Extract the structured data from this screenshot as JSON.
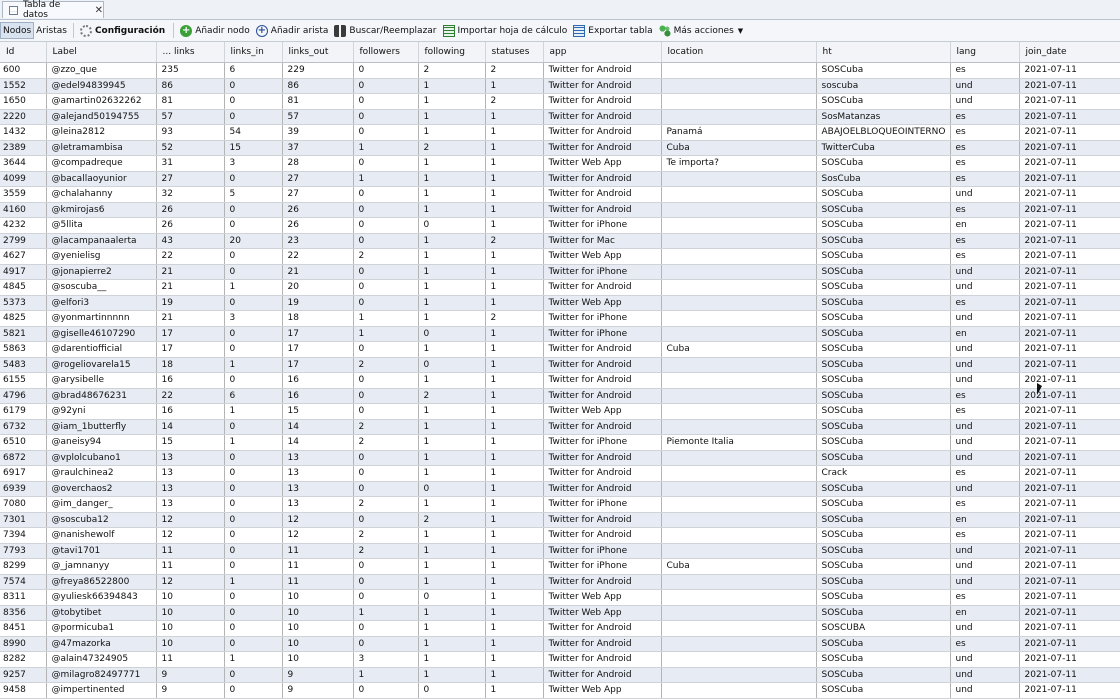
{
  "tab": {
    "title": "Tabla de datos",
    "close": "✕"
  },
  "toolbar": {
    "nodes": "Nodos",
    "edges": "Aristas",
    "config": "Configuración",
    "add_node": "Añadir nodo",
    "add_edge": "Añadir arista",
    "search_replace": "Buscar/Reemplazar",
    "import_sheet": "Importar hoja de cálculo",
    "export_table": "Exportar tabla",
    "more_actions": "Más acciones"
  },
  "columns": [
    "Id",
    "Label",
    "... links",
    "links_in",
    "links_out",
    "followers",
    "following",
    "statuses",
    "app",
    "location",
    "ht",
    "lang",
    "join_date"
  ],
  "rows": [
    [
      "600",
      "@zzo_que",
      "235",
      "6",
      "229",
      "0",
      "2",
      "2",
      "Twitter for Android",
      "",
      "SOSCuba",
      "es",
      "2021-07-11"
    ],
    [
      "1552",
      "@edel94839945",
      "86",
      "0",
      "86",
      "0",
      "1",
      "1",
      "Twitter for Android",
      "",
      "soscuba",
      "und",
      "2021-07-11"
    ],
    [
      "1650",
      "@amartin02632262",
      "81",
      "0",
      "81",
      "0",
      "1",
      "2",
      "Twitter for Android",
      "",
      "SOSCuba",
      "und",
      "2021-07-11"
    ],
    [
      "2220",
      "@alejand50194755",
      "57",
      "0",
      "57",
      "0",
      "1",
      "1",
      "Twitter for Android",
      "",
      "SosMatanzas",
      "es",
      "2021-07-11"
    ],
    [
      "1432",
      "@leina2812",
      "93",
      "54",
      "39",
      "0",
      "1",
      "1",
      "Twitter for Android",
      "Panamá",
      "ABAJOELBLOQUEOINTERNO",
      "es",
      "2021-07-11"
    ],
    [
      "2389",
      "@letramambisa",
      "52",
      "15",
      "37",
      "1",
      "2",
      "1",
      "Twitter for Android",
      "Cuba",
      "TwitterCuba",
      "es",
      "2021-07-11"
    ],
    [
      "3644",
      "@compadreque",
      "31",
      "3",
      "28",
      "0",
      "1",
      "1",
      "Twitter Web App",
      "Te importa?",
      "SOSCuba",
      "es",
      "2021-07-11"
    ],
    [
      "4099",
      "@bacallaoyunior",
      "27",
      "0",
      "27",
      "1",
      "1",
      "1",
      "Twitter for Android",
      "",
      "SosCuba",
      "es",
      "2021-07-11"
    ],
    [
      "3559",
      "@chalahanny",
      "32",
      "5",
      "27",
      "0",
      "1",
      "1",
      "Twitter for Android",
      "",
      "SOSCuba",
      "und",
      "2021-07-11"
    ],
    [
      "4160",
      "@kmirojas6",
      "26",
      "0",
      "26",
      "0",
      "1",
      "1",
      "Twitter for Android",
      "",
      "SOSCuba",
      "es",
      "2021-07-11"
    ],
    [
      "4232",
      "@5llita",
      "26",
      "0",
      "26",
      "0",
      "0",
      "1",
      "Twitter for iPhone",
      "",
      "SOSCuba",
      "en",
      "2021-07-11"
    ],
    [
      "2799",
      "@lacampanaalerta",
      "43",
      "20",
      "23",
      "0",
      "1",
      "2",
      "Twitter for Mac",
      "",
      "SOSCuba",
      "es",
      "2021-07-11"
    ],
    [
      "4627",
      "@yenielisg",
      "22",
      "0",
      "22",
      "2",
      "1",
      "1",
      "Twitter Web App",
      "",
      "SOSCuba",
      "es",
      "2021-07-11"
    ],
    [
      "4917",
      "@jonapierre2",
      "21",
      "0",
      "21",
      "0",
      "1",
      "1",
      "Twitter for iPhone",
      "",
      "SOSCuba",
      "und",
      "2021-07-11"
    ],
    [
      "4845",
      "@soscuba__",
      "21",
      "1",
      "20",
      "0",
      "1",
      "1",
      "Twitter for Android",
      "",
      "SOSCuba",
      "und",
      "2021-07-11"
    ],
    [
      "5373",
      "@elfori3",
      "19",
      "0",
      "19",
      "0",
      "1",
      "1",
      "Twitter Web App",
      "",
      "SOSCuba",
      "es",
      "2021-07-11"
    ],
    [
      "4825",
      "@yonmartinnnnn",
      "21",
      "3",
      "18",
      "1",
      "1",
      "2",
      "Twitter for iPhone",
      "",
      "SOSCuba",
      "und",
      "2021-07-11"
    ],
    [
      "5821",
      "@giselle46107290",
      "17",
      "0",
      "17",
      "1",
      "0",
      "1",
      "Twitter for iPhone",
      "",
      "SOSCuba",
      "en",
      "2021-07-11"
    ],
    [
      "5863",
      "@darentiofficial",
      "17",
      "0",
      "17",
      "0",
      "1",
      "1",
      "Twitter for Android",
      "Cuba",
      "SOSCuba",
      "und",
      "2021-07-11"
    ],
    [
      "5483",
      "@rogeliovarela15",
      "18",
      "1",
      "17",
      "2",
      "0",
      "1",
      "Twitter for Android",
      "",
      "SOSCuba",
      "und",
      "2021-07-11"
    ],
    [
      "6155",
      "@arysibelle",
      "16",
      "0",
      "16",
      "0",
      "1",
      "1",
      "Twitter for Android",
      "",
      "SOSCuba",
      "und",
      "2021-07-11"
    ],
    [
      "4796",
      "@brad48676231",
      "22",
      "6",
      "16",
      "0",
      "2",
      "1",
      "Twitter for Android",
      "",
      "SOSCuba",
      "es",
      "2021-07-11"
    ],
    [
      "6179",
      "@92yni",
      "16",
      "1",
      "15",
      "0",
      "1",
      "1",
      "Twitter Web App",
      "",
      "SOSCuba",
      "es",
      "2021-07-11"
    ],
    [
      "6732",
      "@iam_1butterfly",
      "14",
      "0",
      "14",
      "2",
      "1",
      "1",
      "Twitter for Android",
      "",
      "SOSCuba",
      "und",
      "2021-07-11"
    ],
    [
      "6510",
      "@aneisy94",
      "15",
      "1",
      "14",
      "2",
      "1",
      "1",
      "Twitter for iPhone",
      "Piemonte  Italia",
      "SOSCuba",
      "und",
      "2021-07-11"
    ],
    [
      "6872",
      "@vplolcubano1",
      "13",
      "0",
      "13",
      "0",
      "1",
      "1",
      "Twitter for Android",
      "",
      "SOSCuba",
      "und",
      "2021-07-11"
    ],
    [
      "6917",
      "@raulchinea2",
      "13",
      "0",
      "13",
      "0",
      "1",
      "1",
      "Twitter for Android",
      "",
      "Crack",
      "es",
      "2021-07-11"
    ],
    [
      "6939",
      "@overchaos2",
      "13",
      "0",
      "13",
      "0",
      "0",
      "1",
      "Twitter for Android",
      "",
      "SOSCuba",
      "und",
      "2021-07-11"
    ],
    [
      "7080",
      "@im_danger_",
      "13",
      "0",
      "13",
      "2",
      "1",
      "1",
      "Twitter for iPhone",
      "",
      "SOSCuba",
      "es",
      "2021-07-11"
    ],
    [
      "7301",
      "@soscuba12",
      "12",
      "0",
      "12",
      "0",
      "2",
      "1",
      "Twitter for Android",
      "",
      "SOSCuba",
      "en",
      "2021-07-11"
    ],
    [
      "7394",
      "@nanishewolf",
      "12",
      "0",
      "12",
      "2",
      "1",
      "1",
      "Twitter for Android",
      "",
      "SOSCuba",
      "es",
      "2021-07-11"
    ],
    [
      "7793",
      "@tavi1701",
      "11",
      "0",
      "11",
      "2",
      "1",
      "1",
      "Twitter for iPhone",
      "",
      "SOSCuba",
      "und",
      "2021-07-11"
    ],
    [
      "8299",
      "@_jamnanyy",
      "11",
      "0",
      "11",
      "0",
      "1",
      "1",
      "Twitter for iPhone",
      "Cuba",
      "SOSCuba",
      "und",
      "2021-07-11"
    ],
    [
      "7574",
      "@freya86522800",
      "12",
      "1",
      "11",
      "0",
      "1",
      "1",
      "Twitter for Android",
      "",
      "SOSCuba",
      "und",
      "2021-07-11"
    ],
    [
      "8311",
      "@yuliesk66394843",
      "10",
      "0",
      "10",
      "0",
      "0",
      "1",
      "Twitter Web App",
      "",
      "SOSCuba",
      "es",
      "2021-07-11"
    ],
    [
      "8356",
      "@tobytibet",
      "10",
      "0",
      "10",
      "1",
      "1",
      "1",
      "Twitter Web App",
      "",
      "SOSCuba",
      "en",
      "2021-07-11"
    ],
    [
      "8451",
      "@pormicuba1",
      "10",
      "0",
      "10",
      "0",
      "1",
      "1",
      "Twitter for Android",
      "",
      "SOSCUBA",
      "und",
      "2021-07-11"
    ],
    [
      "8990",
      "@47mazorka",
      "10",
      "0",
      "10",
      "0",
      "1",
      "1",
      "Twitter for Android",
      "",
      "SOSCuba",
      "es",
      "2021-07-11"
    ],
    [
      "8282",
      "@alain47324905",
      "11",
      "1",
      "10",
      "3",
      "1",
      "1",
      "Twitter for Android",
      "",
      "SOSCuba",
      "und",
      "2021-07-11"
    ],
    [
      "9257",
      "@milagro82497771",
      "9",
      "0",
      "9",
      "1",
      "1",
      "1",
      "Twitter for Android",
      "",
      "SOSCuba",
      "und",
      "2021-07-11"
    ],
    [
      "9458",
      "@impertinented",
      "9",
      "0",
      "9",
      "0",
      "0",
      "1",
      "Twitter Web App",
      "",
      "SOSCuba",
      "und",
      "2021-07-11"
    ]
  ]
}
